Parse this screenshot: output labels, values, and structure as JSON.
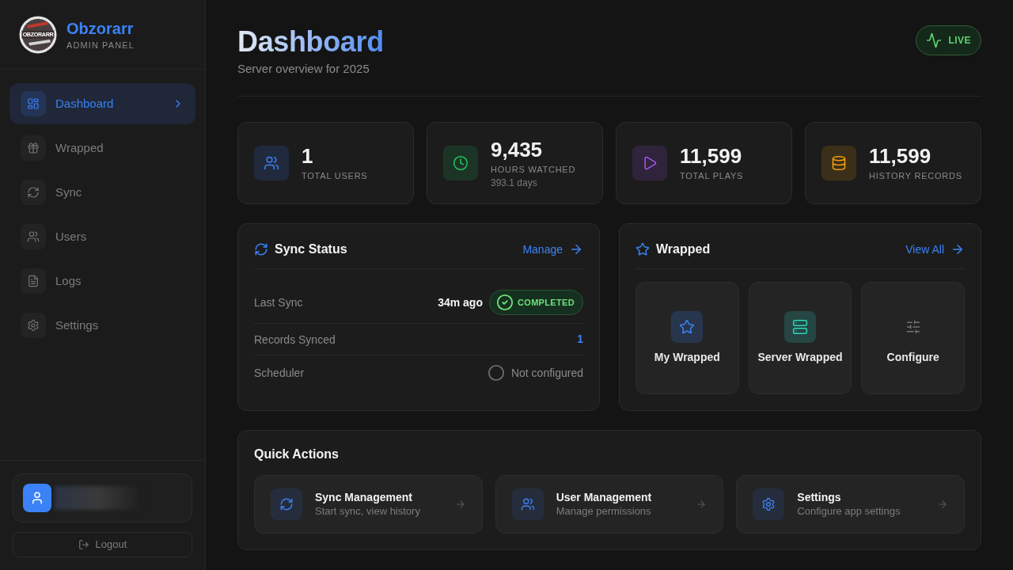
{
  "sidebar": {
    "brand": {
      "logo_text": "OBZORARR",
      "name": "Obzorarr",
      "subtitle": "ADMIN PANEL"
    },
    "nav": [
      {
        "label": "Dashboard",
        "selected": true
      },
      {
        "label": "Wrapped",
        "selected": false
      },
      {
        "label": "Sync",
        "selected": false
      },
      {
        "label": "Users",
        "selected": false
      },
      {
        "label": "Logs",
        "selected": false
      },
      {
        "label": "Settings",
        "selected": false
      }
    ],
    "logout": "Logout"
  },
  "header": {
    "title": "Dashboard",
    "subtitle": "Server overview for 2025",
    "live_badge": "LIVE"
  },
  "stats": [
    {
      "value": "1",
      "label": "TOTAL USERS",
      "color": "#3b82f6"
    },
    {
      "value": "9,435",
      "label": "HOURS WATCHED",
      "detail": "393.1 days",
      "color": "#22c55e"
    },
    {
      "value": "11,599",
      "label": "TOTAL PLAYS",
      "color": "#a855f7"
    },
    {
      "value": "11,599",
      "label": "HISTORY RECORDS",
      "color": "#f59e0b"
    }
  ],
  "sync_status": {
    "title": "Sync Status",
    "link": "Manage",
    "rows": [
      {
        "kind": "time",
        "label": "Last Sync",
        "value": "34m ago",
        "badge": {
          "text": "COMPLETED",
          "kind": "success"
        }
      },
      {
        "kind": "count",
        "label": "Records Synced",
        "value": "1"
      },
      {
        "kind": "state",
        "label": "Scheduler",
        "value": "Not configured",
        "configured": false
      }
    ]
  },
  "wrapped": {
    "title": "Wrapped",
    "link": "View All",
    "tiles": [
      {
        "label": "My Wrapped",
        "kind": "accent",
        "color": "#3b82f6"
      },
      {
        "label": "Server Wrapped",
        "kind": "accent",
        "color": "#2dd4bf"
      },
      {
        "label": "Configure",
        "kind": "plain",
        "color": "#737373"
      }
    ]
  },
  "quick_actions": {
    "title": "Quick Actions",
    "items": [
      {
        "title": "Sync Management",
        "subtitle": "Start sync, view history"
      },
      {
        "title": "User Management",
        "subtitle": "Manage permissions"
      },
      {
        "title": "Settings",
        "subtitle": "Configure app settings"
      }
    ]
  }
}
